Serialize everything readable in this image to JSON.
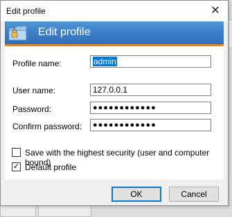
{
  "window": {
    "title": "Edit profile",
    "close_glyph": "✕"
  },
  "banner": {
    "title": "Edit profile",
    "icon": "folder-lock-icon",
    "bg_color": "#3a7dc6",
    "accent_color": "#e9891a"
  },
  "form": {
    "profile_name_label": "Profile name:",
    "profile_name_value": "admin",
    "user_name_label": "User name:",
    "user_name_value": "127.0.0.1",
    "password_label": "Password:",
    "password_value": "●●●●●●●●●●●●",
    "confirm_password_label": "Confirm password:",
    "confirm_password_value": "●●●●●●●●●●●●"
  },
  "options": {
    "highest_security_label": "Save with the highest security (user and computer bound)",
    "highest_security_checked": false,
    "default_profile_label": "Default profile",
    "default_profile_checked": true,
    "check_glyph": "✓"
  },
  "buttons": {
    "ok_label": "OK",
    "cancel_label": "Cancel"
  }
}
